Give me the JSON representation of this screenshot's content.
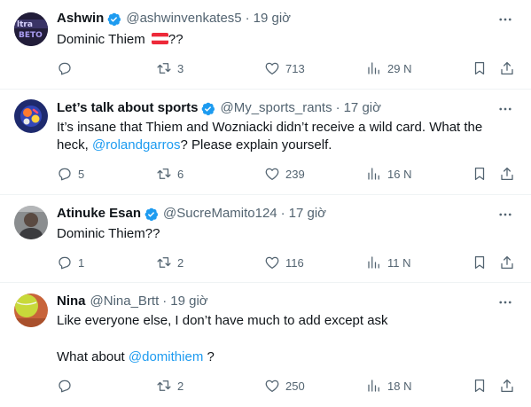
{
  "tweets": [
    {
      "name": "Ashwin",
      "handle": "@ashwinvenkates5",
      "dot": "·",
      "time": "19 giờ",
      "text_before": "Dominic Thiem",
      "text_after": "??",
      "replies": "",
      "retweets": "3",
      "likes": "713",
      "views": "29 N",
      "avatar_text": "ltra BETO"
    },
    {
      "name": "Let’s talk about sports",
      "handle": "@My_sports_rants",
      "dot": "·",
      "time": "17 giờ",
      "text_line1": "It’s insane that Thiem and Wozniacki didn’t receive a wild card. What the",
      "text_line2_before": "heck, ",
      "mention": "@rolandgarros",
      "text_line2_after": "? Please explain yourself.",
      "replies": "5",
      "retweets": "6",
      "likes": "239",
      "views": "16 N"
    },
    {
      "name": "Atinuke Esan",
      "handle": "@SucreMamito124",
      "dot": "·",
      "time": "17 giờ",
      "text": "Dominic Thiem??",
      "replies": "1",
      "retweets": "2",
      "likes": "116",
      "views": "11 N"
    },
    {
      "name": "Nina",
      "handle": "@Nina_Brtt",
      "dot": "·",
      "time": "19 giờ",
      "text_line1": "Like everyone else, I don’t have much to add except ask",
      "text_line3_before": "What about ",
      "mention": "@domithiem",
      "text_line3_after": " ?",
      "replies": "",
      "retweets": "2",
      "likes": "250",
      "views": "18 N"
    }
  ],
  "colors": {
    "text": "#0f1419",
    "secondary": "#536471",
    "link": "#1d9bf0",
    "verified": "#1d9bf0",
    "divider": "#eff3f4"
  },
  "icons": [
    "verified-badge-icon",
    "more-icon",
    "reply-icon",
    "retweet-icon",
    "like-icon",
    "views-icon",
    "bookmark-icon",
    "share-icon",
    "austria-flag-icon"
  ]
}
